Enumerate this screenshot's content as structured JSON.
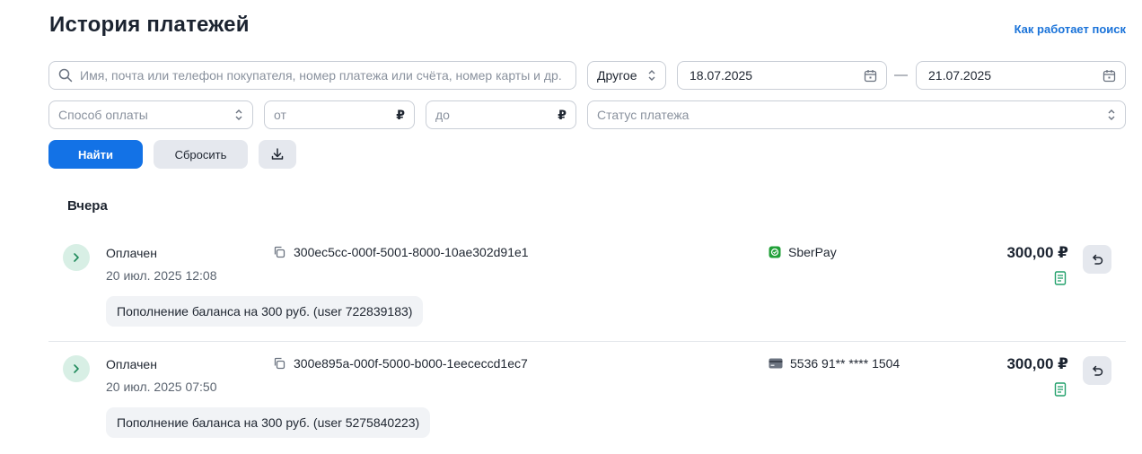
{
  "header": {
    "title": "История платежей",
    "help_link": "Как работает поиск"
  },
  "filters": {
    "search_placeholder": "Имя, почта или телефон покупателя, номер платежа или счёта, номер карты и др.",
    "period": "Другое",
    "date_from": "18.07.2025",
    "date_separator": "—",
    "date_to": "21.07.2025",
    "payment_method_placeholder": "Способ оплаты",
    "amount_from_placeholder": "от",
    "amount_to_placeholder": "до",
    "currency_symbol": "₽",
    "status_placeholder": "Статус платежа"
  },
  "actions": {
    "find": "Найти",
    "reset": "Сбросить"
  },
  "section_title": "Вчера",
  "payments": [
    {
      "status": "Оплачен",
      "datetime": "20 июл. 2025 12:08",
      "id": "300ec5cc-000f-5001-8000-10ae302d91e1",
      "method": "SberPay",
      "method_icon": "sberpay-icon",
      "amount": "300,00 ₽",
      "description": "Пополнение баланса на 300 руб. (user 722839183)"
    },
    {
      "status": "Оплачен",
      "datetime": "20 июл. 2025 07:50",
      "id": "300e895a-000f-5000-b000-1eececcd1ec7",
      "method": "5536 91** **** 1504",
      "method_icon": "bank-card-icon",
      "amount": "300,00 ₽",
      "description": "Пополнение баланса на 300 руб. (user 5275840223)"
    }
  ],
  "colors": {
    "accent": "#1372e6",
    "link": "#1a73d9",
    "success": "#22a06b",
    "expand_bg": "#d8efe5"
  }
}
